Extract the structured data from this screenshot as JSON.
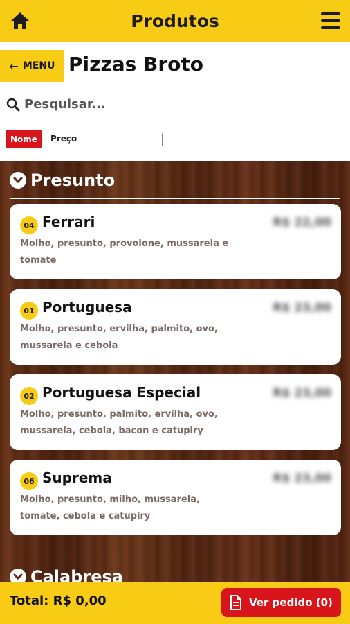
{
  "header": {
    "title": "Produtos",
    "home_icon": "home-icon",
    "menu_icon": "hamburger-menu-icon"
  },
  "category_bar": {
    "back_label": "MENU",
    "back_icon": "arrow-left-icon",
    "category_title": "Pizzas Broto"
  },
  "search": {
    "placeholder": "Pesquisar...",
    "value": ""
  },
  "sort": {
    "options": [
      "Nome",
      "Preço"
    ],
    "active": "Nome"
  },
  "sections": [
    {
      "title": "Presunto",
      "products": [
        {
          "code": "04",
          "name": "Ferrari",
          "price": "R$ 22,00",
          "description": "Molho, presunto, provolone, mussarela e tomate"
        },
        {
          "code": "01",
          "name": "Portuguesa",
          "price": "R$ 23,00",
          "description": "Molho, presunto, ervilha, palmito, ovo, mussarela e cebola"
        },
        {
          "code": "02",
          "name": "Portuguesa Especial",
          "price": "R$ 23,00",
          "description": "Molho, presunto, palmito, ervilha, ovo, mussarela, cebola, bacon e catupiry"
        },
        {
          "code": "06",
          "name": "Suprema",
          "price": "R$ 23,00",
          "description": "Molho, presunto, milho, mussarela, tomate, cebola e catupiry"
        }
      ]
    },
    {
      "title": "Calabresa",
      "products": []
    }
  ],
  "footer": {
    "total_label": "Total: R$ 0,00",
    "order_button": "Ver pedido (0)",
    "order_icon": "document-icon"
  },
  "colors": {
    "accent_yellow": "#f8cc14",
    "accent_red": "#d8151b",
    "wood_brown": "#5a2a14"
  }
}
